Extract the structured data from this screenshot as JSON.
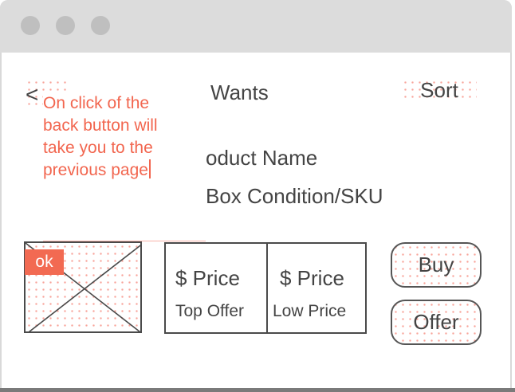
{
  "window": {
    "traffic_lights": [
      "close",
      "minimize",
      "maximize"
    ]
  },
  "header": {
    "back_label": "<",
    "title": "Wants",
    "sort_label": "Sort"
  },
  "annotation": {
    "text": "On click of the\nback button will\ntake you to the\nprevious page"
  },
  "product": {
    "name": "oduct Name",
    "condition_sku": "Box Condition/SKU",
    "image_badge": "ok"
  },
  "prices": [
    {
      "value": "$ Price",
      "label": "Top Offer"
    },
    {
      "value": "$ Price",
      "label": "Low Price"
    }
  ],
  "actions": {
    "buy_label": "Buy",
    "offer_label": "Offer"
  },
  "colors": {
    "annotation": "#f2664f",
    "badge": "#f26a52",
    "text": "#444444",
    "titlebar": "#dcdcdc"
  }
}
